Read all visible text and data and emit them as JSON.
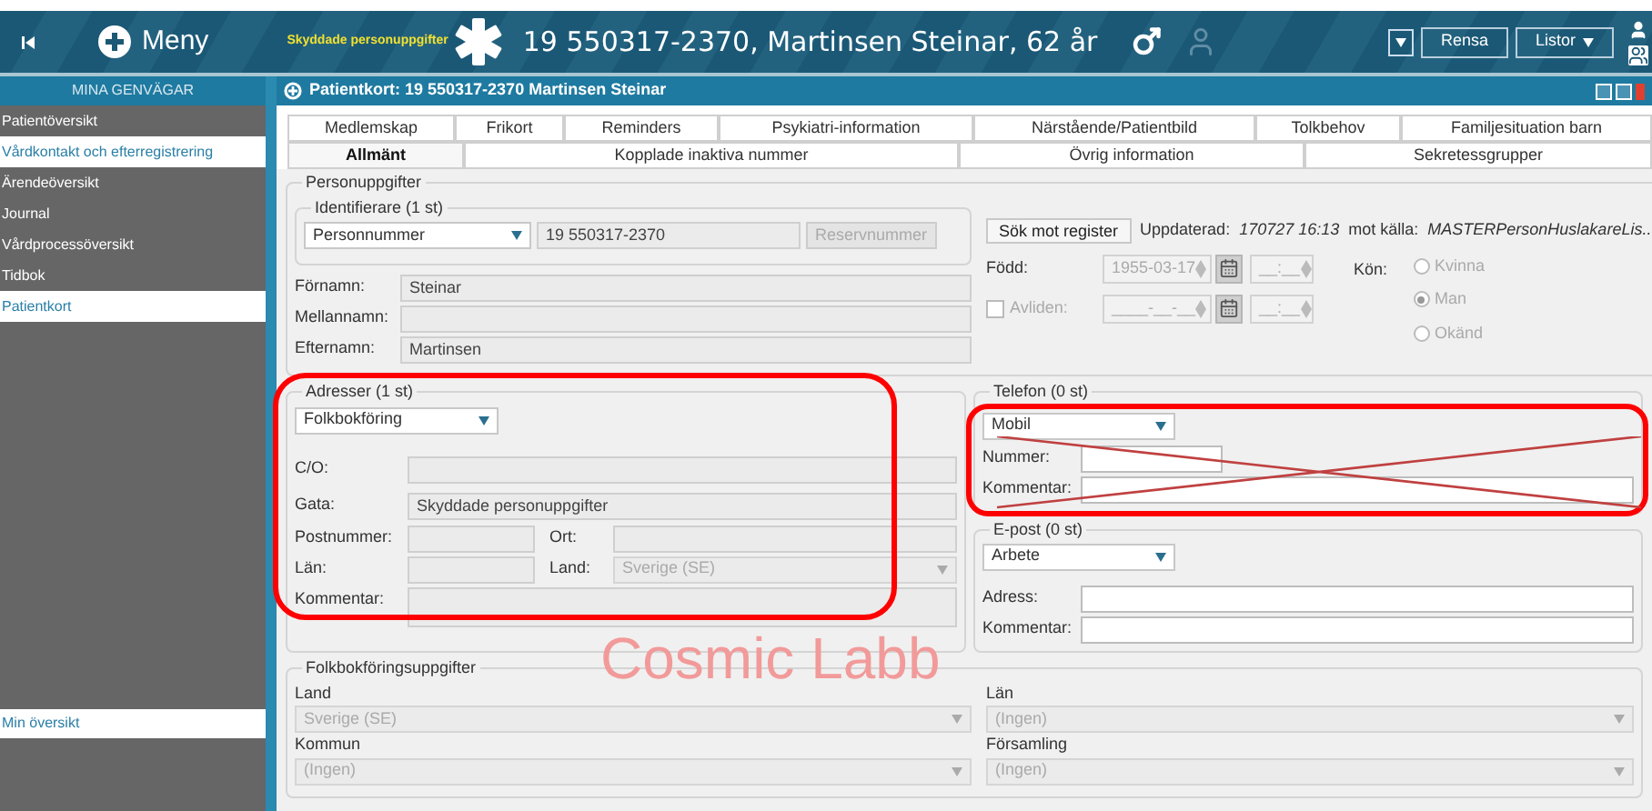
{
  "header": {
    "menu_label": "Meny",
    "protected_label": "Skyddade personuppgifter",
    "patient": "19 550317-2370, Martinsen Steinar, 62 år",
    "buttons": [
      {
        "label": "Rensa",
        "kind": "plain"
      },
      {
        "label": "Listor",
        "kind": "menu"
      }
    ]
  },
  "sidebar": {
    "title": "MINA GENVÄGAR",
    "items": [
      {
        "label": "Patientöversikt",
        "selected": false
      },
      {
        "label": "Vårdkontakt och efterregistrering",
        "selected": true
      },
      {
        "label": "Ärendeöversikt",
        "selected": false
      },
      {
        "label": "Journal",
        "selected": false
      },
      {
        "label": "Vårdprocessöversikt",
        "selected": false
      },
      {
        "label": "Tidbok",
        "selected": false
      },
      {
        "label": "Patientkort",
        "selected": true
      }
    ],
    "bottom_items": [
      {
        "label": "Min översikt",
        "selected": true
      }
    ]
  },
  "window": {
    "title": "Patientkort: 19 550317-2370 Martinsen Steinar"
  },
  "tabs_row_1": [
    {
      "label": "Medlemskap",
      "selected": false
    },
    {
      "label": "Frikort",
      "selected": false
    },
    {
      "label": "Reminders",
      "selected": false
    },
    {
      "label": "Psykiatri-information",
      "selected": false
    },
    {
      "label": "Närstående/Patientbild",
      "selected": false
    },
    {
      "label": "Tolkbehov",
      "selected": false
    },
    {
      "label": "Familjesituation barn",
      "selected": false
    }
  ],
  "tabs_row_2": [
    {
      "label": "Allmänt",
      "selected": true
    },
    {
      "label": "Kopplade inaktiva nummer",
      "selected": false
    },
    {
      "label": "Övrig information",
      "selected": false
    },
    {
      "label": "Sekretessgrupper",
      "selected": false
    }
  ],
  "personuppgifter": {
    "title": "Personuppgifter",
    "identifierare": {
      "title": "Identifierare (1 st)",
      "type": "Personnummer",
      "value": "19 550317-2370",
      "button": {
        "label": "Reservnummer",
        "disabled": true
      }
    },
    "names": [
      {
        "label": "Förnamn:",
        "value": "Steinar"
      },
      {
        "label": "Mellannamn:"
      },
      {
        "label": "Efternamn:",
        "value": "Martinsen"
      }
    ],
    "search_button": "Sök mot register",
    "updated_label": "Uppdaterad:",
    "updated_value": "170727 16:13",
    "source_label": "mot källa:",
    "source_value": "MASTERPersonHuslakareLis...",
    "born": {
      "label": "Född:",
      "date": "1955-03-17",
      "time": "__:__"
    },
    "deceased": {
      "label": "Avliden:",
      "checked": false,
      "date": "____-__-__",
      "time": "__:__"
    },
    "gender": {
      "label": "Kön:",
      "options": [
        {
          "label": "Kvinna",
          "selected": false
        },
        {
          "label": "Man",
          "selected": true
        },
        {
          "label": "Okänd",
          "selected": false
        }
      ]
    }
  },
  "adresser": {
    "title": "Adresser (1 st)",
    "type": "Folkbokföring",
    "co": {
      "label": "C/O:"
    },
    "gata": {
      "label": "Gata:",
      "value": "Skyddade personuppgifter"
    },
    "postnummer": {
      "label": "Postnummer:"
    },
    "ort": {
      "label": "Ort:"
    },
    "lan": {
      "label": "Län:"
    },
    "land": {
      "label": "Land:",
      "value": "Sverige (SE)"
    },
    "kommentar": {
      "label": "Kommentar:"
    }
  },
  "telefon": {
    "title": "Telefon (0 st)",
    "type": "Mobil",
    "nummer_label": "Nummer:",
    "kommentar_label": "Kommentar:"
  },
  "epost": {
    "title": "E-post (0 st)",
    "type": "Arbete",
    "adress_label": "Adress:",
    "kommentar_label": "Kommentar:"
  },
  "folkbokforing": {
    "title": "Folkbokföringsuppgifter",
    "fields": [
      {
        "label": "Land",
        "value": "Sverige (SE)"
      },
      {
        "label": "Län",
        "value": "(Ingen)"
      },
      {
        "label": "Kommun",
        "value": "(Ingen)"
      },
      {
        "label": "Församling",
        "value": "(Ingen)"
      }
    ]
  },
  "environment_label": "Cosmic Labb"
}
